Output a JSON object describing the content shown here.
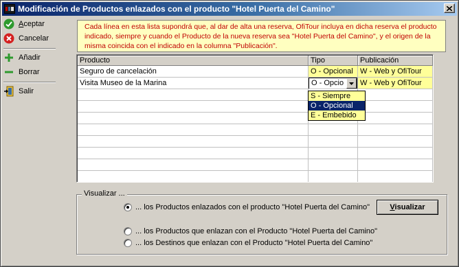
{
  "window": {
    "title": "Modificación de Productos enlazados con el producto \"Hotel Puerta del Camino\""
  },
  "toolbar": {
    "aceptar_first": "A",
    "aceptar_rest": "ceptar",
    "cancelar": "Cancelar",
    "anadir": "Añadir",
    "borrar": "Borrar",
    "salir": "Salir"
  },
  "info": {
    "text": "Cada línea en esta lista supondrá que, al dar de alta una reserva, OfiTour incluya en dicha reserva el producto indicado, siempre y cuando el Producto de la nueva reserva sea \"Hotel Puerta del Camino\", y el origen de la misma coincida con el indicado en la columna \"Publicación\"."
  },
  "grid": {
    "columns": [
      "Producto",
      "Tipo",
      "Publicación"
    ],
    "rows": [
      {
        "producto": "Seguro de cancelación",
        "tipo": "O - Opcional",
        "publicacion": "W - Web y OfiTour"
      },
      {
        "producto": "Visita Museo de la Marina",
        "tipo": "O - Opcio",
        "publicacion": "W - Web y OfiTour"
      }
    ],
    "empty_rows": 8
  },
  "dropdown": {
    "options": [
      "S - Siempre",
      "O - Opcional",
      "E - Embebido"
    ],
    "selected_index": 1
  },
  "visualizar": {
    "legend": "Visualizar ...",
    "options": [
      "...  los Productos enlazados con el producto \"Hotel Puerta del Camino\"",
      "...  los Productos que enlazan con el Producto \"Hotel Puerta del Camino\"",
      "...  los Destinos que enlazan con el Producto \"Hotel Puerta del Camino\""
    ],
    "selected_index": 0,
    "button_first": "V",
    "button_rest": "isualizar"
  },
  "icons": {
    "aceptar": "check-icon",
    "cancelar": "cancel-icon",
    "anadir": "plus-icon",
    "borrar": "minus-icon",
    "salir": "exit-door-icon"
  },
  "colors": {
    "titlebar": "#0a246a",
    "banner_bg": "#ffffc0",
    "banner_text": "#c00000",
    "cell_highlight": "#ffff99",
    "selection": "#0a246a"
  }
}
